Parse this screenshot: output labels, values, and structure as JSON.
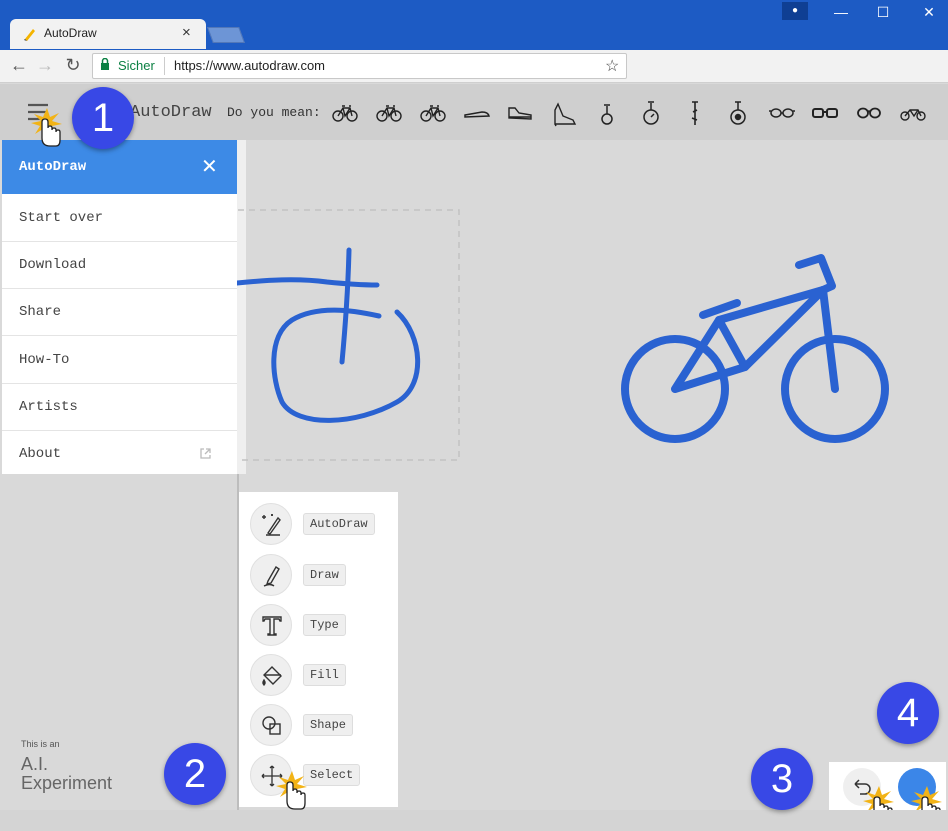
{
  "browser": {
    "tab_title": "AutoDraw",
    "tab_close": "×",
    "secure_label": "Sicher",
    "url": "https://www.autodraw.com",
    "window_controls": [
      "—",
      "☐",
      "✕"
    ]
  },
  "app": {
    "title": "AutoDraw",
    "suggestion_label": "Do you mean:",
    "suggestions": [
      "bicycle",
      "bicycle",
      "bicycle",
      "shoe",
      "sneaker",
      "high-heel",
      "unicycle",
      "unicycle",
      "unicycle",
      "unicycle",
      "glasses",
      "glasses",
      "glasses",
      "motorcycle"
    ]
  },
  "drawer": {
    "title": "AutoDraw",
    "items": [
      "Start over",
      "Download",
      "Share",
      "How-To",
      "Artists",
      "About"
    ]
  },
  "tools": [
    {
      "label": "AutoDraw",
      "icon": "autodraw-wand-icon"
    },
    {
      "label": "Draw",
      "icon": "pencil-icon"
    },
    {
      "label": "Type",
      "icon": "text-icon"
    },
    {
      "label": "Fill",
      "icon": "fill-bucket-icon"
    },
    {
      "label": "Shape",
      "icon": "shape-icon"
    },
    {
      "label": "Select",
      "icon": "move-icon"
    }
  ],
  "footer": {
    "small": "This is an",
    "line1": "A.I.",
    "line2": "Experiment"
  },
  "badges": [
    "1",
    "2",
    "3",
    "4"
  ],
  "colors": {
    "accent": "#3d8ae6",
    "badge": "#3848e6",
    "stroke": "#2a62d1",
    "titlebar": "#1d5bc4"
  }
}
